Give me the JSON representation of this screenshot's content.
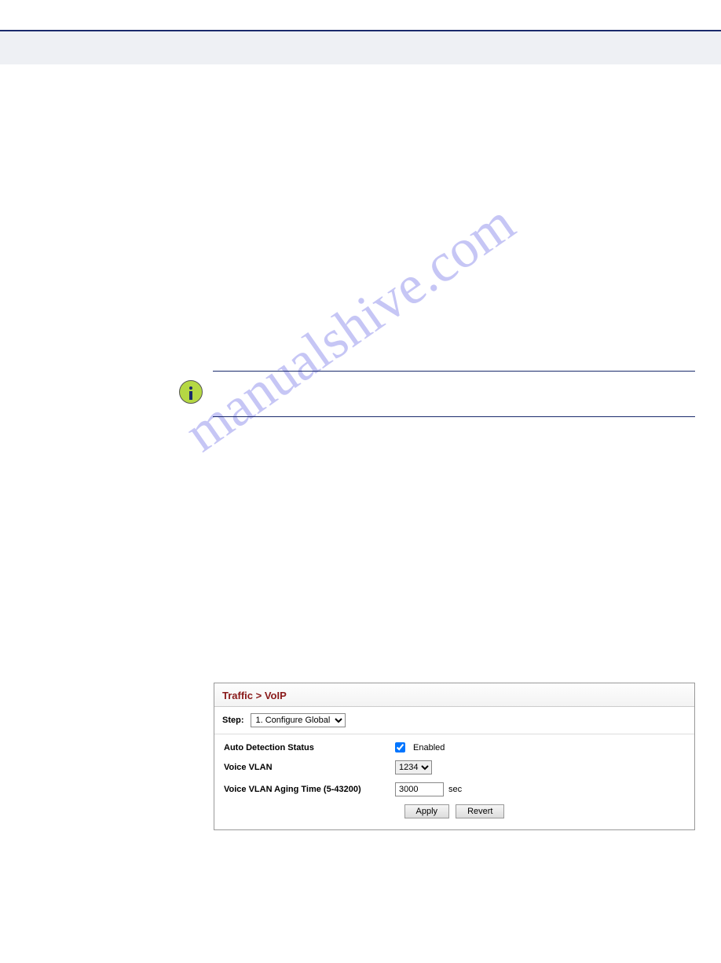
{
  "watermark": "manualshive.com",
  "panel": {
    "title": "Traffic > VoIP",
    "step_label": "Step:",
    "step_value": "1. Configure Global",
    "auto_detect_label": "Auto Detection Status",
    "auto_detect_text": "Enabled",
    "voice_vlan_label": "Voice VLAN",
    "voice_vlan_value": "1234",
    "aging_label": "Voice VLAN Aging Time (5-43200)",
    "aging_value": "3000",
    "aging_unit": "sec",
    "apply": "Apply",
    "revert": "Revert"
  }
}
